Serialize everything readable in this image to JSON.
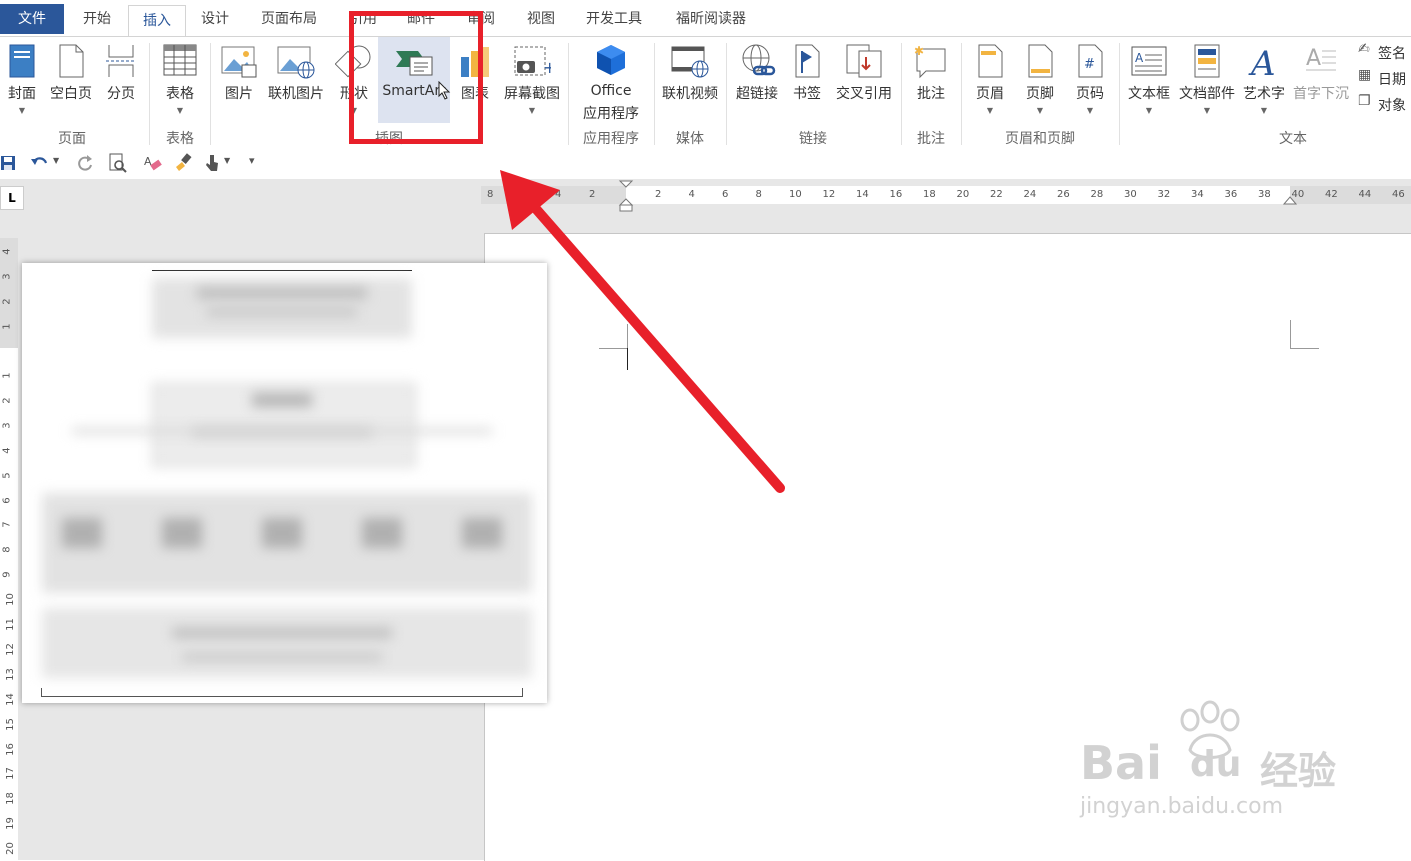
{
  "menu": {
    "tabs": [
      "文件",
      "开始",
      "插入",
      "设计",
      "页面布局",
      "引用",
      "邮件",
      "审阅",
      "视图",
      "开发工具",
      "福昕阅读器"
    ]
  },
  "ribbon": {
    "buttons": {
      "cover": "封面",
      "blank_page": "空白页",
      "page_break": "分页",
      "table": "表格",
      "picture": "图片",
      "online_picture": "联机图片",
      "shapes": "形状",
      "smartart": "SmartArt",
      "chart": "图表",
      "screenshot": "屏幕截图",
      "office_apps_1": "Office",
      "office_apps_2": "应用程序",
      "online_video": "联机视频",
      "hyperlink": "超链接",
      "bookmark": "书签",
      "cross_ref": "交叉引用",
      "comment": "批注",
      "header": "页眉",
      "footer": "页脚",
      "page_number": "页码",
      "textbox": "文本框",
      "quick_parts": "文档部件",
      "wordart": "艺术字",
      "drop_cap": "首字下沉",
      "signature": "签名",
      "date": "日期",
      "object": "对象"
    },
    "groups": {
      "pages": "页面",
      "tables": "表格",
      "illustrations": "插图",
      "apps": "应用程序",
      "media": "媒体",
      "links": "链接",
      "comments": "批注",
      "header_footer": "页眉和页脚",
      "text": "文本"
    }
  },
  "ruler": {
    "corner": "L",
    "h_left": [
      "8",
      "6",
      "4",
      "2"
    ],
    "h_right": [
      "2",
      "4",
      "6",
      "8",
      "10",
      "12",
      "14",
      "16",
      "18",
      "20",
      "22",
      "24",
      "26",
      "28",
      "30",
      "32",
      "34",
      "36",
      "38",
      "40",
      "42",
      "44",
      "46"
    ],
    "v_top": [
      "4",
      "3",
      "2",
      "1"
    ],
    "v_bottom": [
      "1",
      "2",
      "3",
      "4",
      "5",
      "6",
      "7",
      "8",
      "9",
      "10",
      "11",
      "12",
      "13",
      "14",
      "15",
      "16",
      "17",
      "18",
      "19",
      "20"
    ]
  },
  "watermark": {
    "brand": "Bai",
    "brand2": "du",
    "brand_cn": "经验",
    "url": "jingyan.baidu.com"
  },
  "colors": {
    "accent": "#2b579a",
    "annotation_red": "#e8202a"
  }
}
